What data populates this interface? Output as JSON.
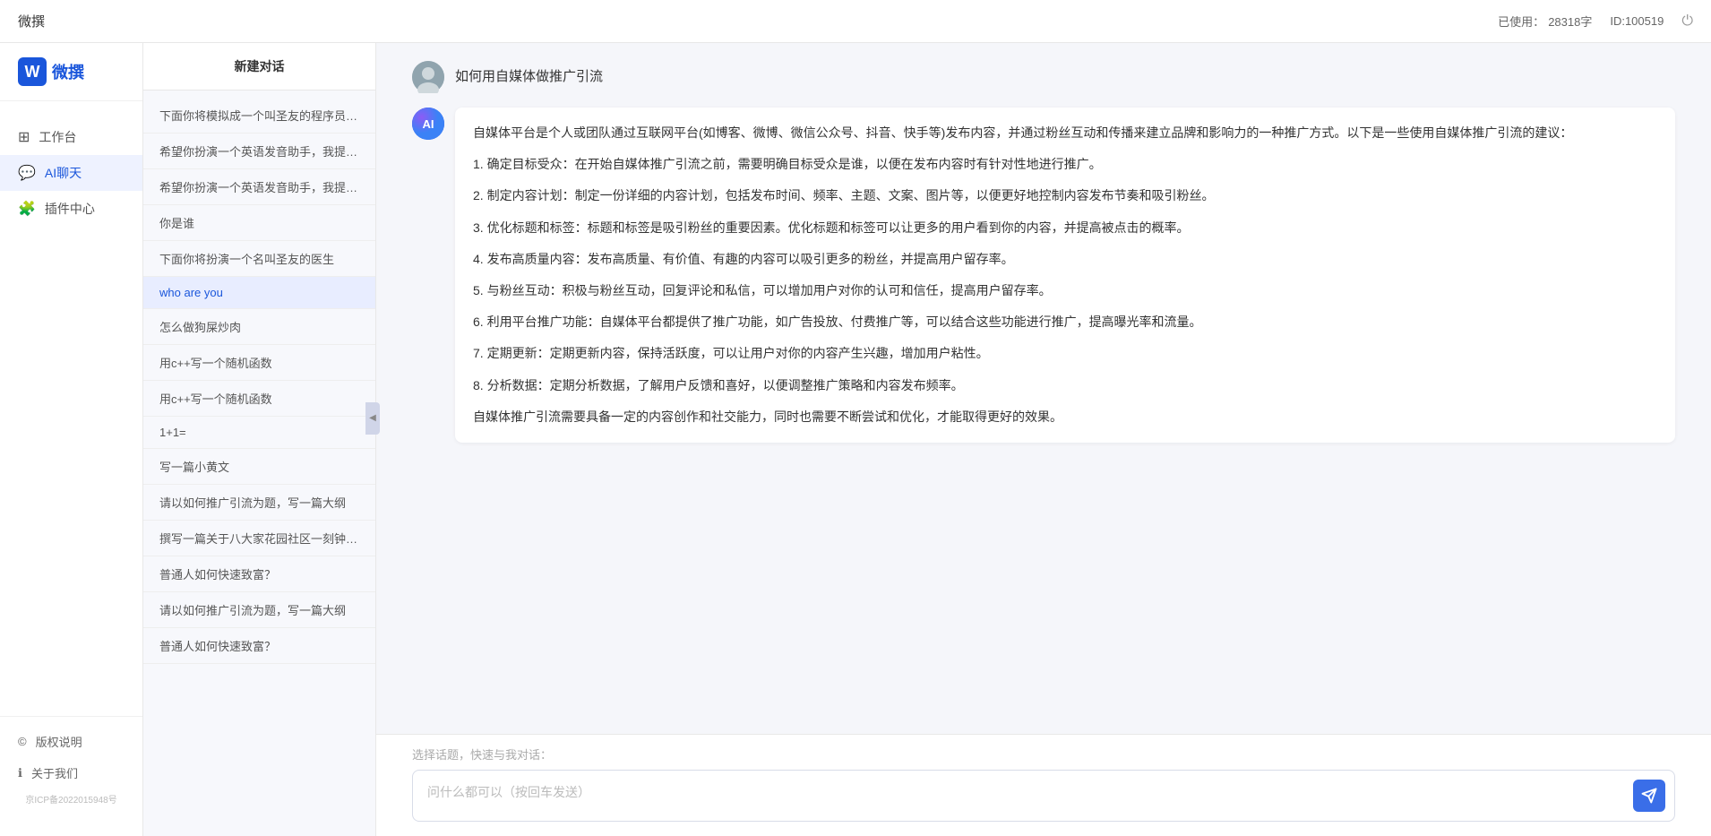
{
  "topbar": {
    "title": "微撰",
    "char_label": "已使用：",
    "char_count": "28318字",
    "user_id_label": "ID:100519",
    "power_icon": "⏻"
  },
  "logo": {
    "w_letter": "W",
    "brand_name": "微撰"
  },
  "nav": {
    "items": [
      {
        "id": "workspace",
        "icon": "⊞",
        "label": "工作台"
      },
      {
        "id": "ai-chat",
        "icon": "💬",
        "label": "AI聊天",
        "active": true
      },
      {
        "id": "plugin",
        "icon": "🧩",
        "label": "插件中心"
      }
    ],
    "bottom_items": [
      {
        "id": "copyright",
        "icon": "©",
        "label": "版权说明"
      },
      {
        "id": "about",
        "icon": "ℹ",
        "label": "关于我们"
      }
    ],
    "icp": "京ICP备2022015948号"
  },
  "chat_sidebar": {
    "new_chat_label": "新建对话",
    "history": [
      {
        "id": 1,
        "text": "下面你将模拟成一个叫圣友的程序员，我说..."
      },
      {
        "id": 2,
        "text": "希望你扮演一个英语发音助手，我提供给你..."
      },
      {
        "id": 3,
        "text": "希望你扮演一个英语发音助手，我提供给你..."
      },
      {
        "id": 4,
        "text": "你是谁"
      },
      {
        "id": 5,
        "text": "下面你将扮演一个名叫圣友的医生"
      },
      {
        "id": 6,
        "text": "who are you",
        "active": true
      },
      {
        "id": 7,
        "text": "怎么做狗屎炒肉"
      },
      {
        "id": 8,
        "text": "用c++写一个随机函数"
      },
      {
        "id": 9,
        "text": "用c++写一个随机函数"
      },
      {
        "id": 10,
        "text": "1+1="
      },
      {
        "id": 11,
        "text": "写一篇小黄文"
      },
      {
        "id": 12,
        "text": "请以如何推广引流为题，写一篇大纲"
      },
      {
        "id": 13,
        "text": "撰写一篇关于八大家花园社区一刻钟便民生..."
      },
      {
        "id": 14,
        "text": "普通人如何快速致富？"
      },
      {
        "id": 15,
        "text": "请以如何推广引流为题，写一篇大纲"
      },
      {
        "id": 16,
        "text": "普通人如何快速致富？"
      }
    ]
  },
  "chat": {
    "user_message": "如何用自媒体做推广引流",
    "ai_response": {
      "paragraphs": [
        "自媒体平台是个人或团队通过互联网平台(如博客、微博、微信公众号、抖音、快手等)发布内容，并通过粉丝互动和传播来建立品牌和影响力的一种推广方式。以下是一些使用自媒体推广引流的建议：",
        "1. 确定目标受众：在开始自媒体推广引流之前，需要明确目标受众是谁，以便在发布内容时有针对性地进行推广。",
        "2. 制定内容计划：制定一份详细的内容计划，包括发布时间、频率、主题、文案、图片等，以便更好地控制内容发布节奏和吸引粉丝。",
        "3. 优化标题和标签：标题和标签是吸引粉丝的重要因素。优化标题和标签可以让更多的用户看到你的内容，并提高被点击的概率。",
        "4. 发布高质量内容：发布高质量、有价值、有趣的内容可以吸引更多的粉丝，并提高用户留存率。",
        "5. 与粉丝互动：积极与粉丝互动，回复评论和私信，可以增加用户对你的认可和信任，提高用户留存率。",
        "6. 利用平台推广功能：自媒体平台都提供了推广功能，如广告投放、付费推广等，可以结合这些功能进行推广，提高曝光率和流量。",
        "7. 定期更新：定期更新内容，保持活跃度，可以让用户对你的内容产生兴趣，增加用户粘性。",
        "8. 分析数据：定期分析数据，了解用户反馈和喜好，以便调整推广策略和内容发布频率。",
        "自媒体推广引流需要具备一定的内容创作和社交能力，同时也需要不断尝试和优化，才能取得更好的效果。"
      ]
    }
  },
  "input": {
    "quick_topics_label": "选择话题，快速与我对话：",
    "placeholder": "问什么都可以（按回车发送）",
    "send_icon": "➤"
  }
}
